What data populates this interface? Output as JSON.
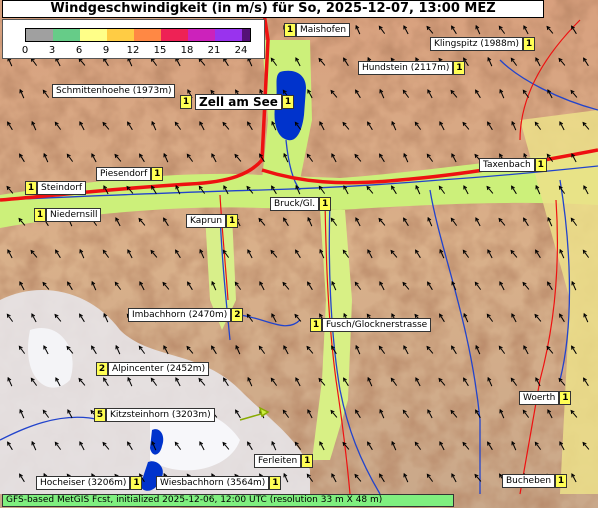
{
  "title": "Windgeschwindigkeit (in m/s) für So, 2025-12-07, 13:00 MEZ",
  "legend": {
    "ticks": [
      "0",
      "3",
      "6",
      "9",
      "12",
      "15",
      "18",
      "21",
      "24"
    ],
    "colors": [
      "#a0a0a0",
      "#66cc88",
      "#ffff88",
      "#ffcc44",
      "#ff8844",
      "#ee2255",
      "#cc22bb",
      "#9933ee",
      "#551177"
    ]
  },
  "places": [
    {
      "name": "Maishofen",
      "value": "1"
    },
    {
      "name": "Klingspitz (1988m)",
      "value": "1"
    },
    {
      "name": "Hundstein (2117m)",
      "value": "1"
    },
    {
      "name": "Schmittenhoehe (1973m)",
      "value": "1"
    },
    {
      "name": "Zell am See",
      "value": "1"
    },
    {
      "name": "Taxenbach",
      "value": "1"
    },
    {
      "name": "Piesendorf",
      "value": "1"
    },
    {
      "name": "Steindorf",
      "value": "1"
    },
    {
      "name": "Niedernsill",
      "value": "1"
    },
    {
      "name": "Kaprun",
      "value": "1"
    },
    {
      "name": "Bruck/Gl.",
      "value": "1"
    },
    {
      "name": "Imbachhorn (2470m)",
      "value": "2"
    },
    {
      "name": "Fusch/Glocknerstrasse",
      "value": "1"
    },
    {
      "name": "Alpincenter (2452m)",
      "value": "2"
    },
    {
      "name": "Kitzsteinhorn (3203m)",
      "value": "5"
    },
    {
      "name": "Woerth",
      "value": "1"
    },
    {
      "name": "Ferleiten",
      "value": "1"
    },
    {
      "name": "Hocheiser (3206m)",
      "value": "1"
    },
    {
      "name": "Wiesbachhorn (3564m)",
      "value": "1"
    },
    {
      "name": "Bucheben",
      "value": "1"
    }
  ],
  "footer": "GFS-based MetGIS Fcst, initialized 2025-12-06, 12:00 UTC  (resolution 33 m X 48 m)",
  "colors": {
    "lake": "#0033cc",
    "river": "#2244cc",
    "road": "#ee1111",
    "valley": "#ccf07a"
  }
}
